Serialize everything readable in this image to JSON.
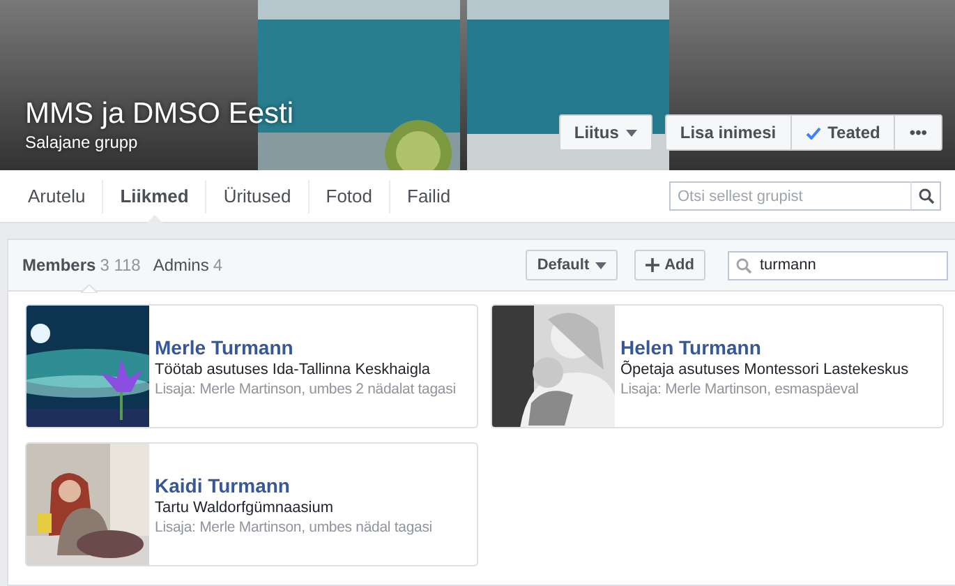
{
  "group": {
    "title": "MMS ja DMSO Eesti",
    "privacy": "Salajane grupp",
    "actions": [
      {
        "kind": "dropdown",
        "label": "Liitus"
      },
      {
        "kind": "plain",
        "label": "Lisa inimesi"
      },
      {
        "kind": "check",
        "label": "Teated"
      },
      {
        "kind": "plain",
        "label": "•••"
      }
    ]
  },
  "tabs": [
    {
      "label": "Arutelu",
      "selected": false
    },
    {
      "label": "Liikmed",
      "selected": true
    },
    {
      "label": "Üritused",
      "selected": false
    },
    {
      "label": "Fotod",
      "selected": false
    },
    {
      "label": "Failid",
      "selected": false
    }
  ],
  "group_search": {
    "placeholder": "Otsi sellest grupist"
  },
  "members_panel": {
    "filters": [
      {
        "label": "Members",
        "count": "3 118",
        "selected": true
      },
      {
        "label": "Admins",
        "count": "4",
        "selected": false
      }
    ],
    "sort": "Default",
    "add": "Add",
    "search": {
      "value": "turmann"
    },
    "members": [
      {
        "name": "Merle Turmann",
        "detail": "Töötab asutuses Ida-Tallinna Keskhaigla",
        "added": "Lisaja: Merle Martinson, umbes 2 nädalat tagasi"
      },
      {
        "name": "Helen Turmann",
        "detail": "Õpetaja asutuses Montessori Lastekeskus",
        "added": "Lisaja: Merle Martinson, esmaspäeval"
      },
      {
        "name": "Kaidi Turmann",
        "detail": "Tartu Waldorfgümnaasium",
        "added": "Lisaja: Merle Martinson, umbes nädal tagasi"
      }
    ]
  }
}
